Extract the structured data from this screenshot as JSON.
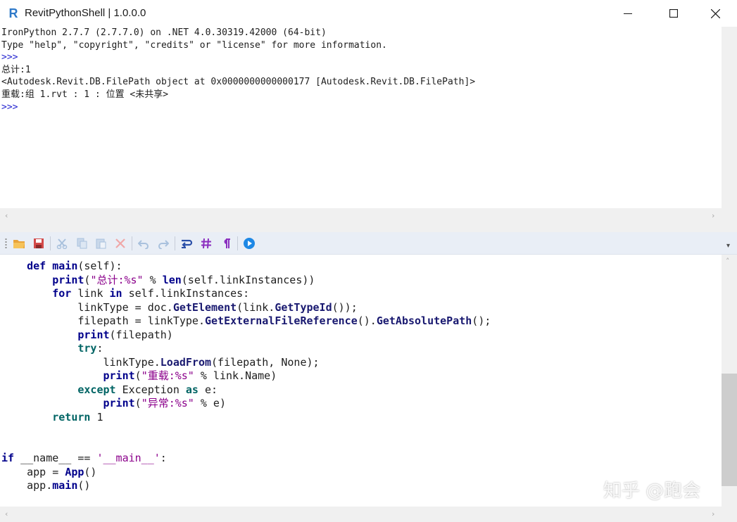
{
  "window": {
    "title": "RevitPythonShell | 1.0.0.0",
    "logo_letter": "R",
    "controls": [
      "minimize-icon",
      "maximize-icon",
      "close-icon"
    ]
  },
  "console": {
    "lines": [
      {
        "type": "output",
        "text": "IronPython 2.7.7 (2.7.7.0) on .NET 4.0.30319.42000 (64-bit)"
      },
      {
        "type": "output",
        "text": "Type \"help\", \"copyright\", \"credits\" or \"license\" for more information."
      },
      {
        "type": "prompt",
        "text": ">>>"
      },
      {
        "type": "output",
        "text": "总计:1"
      },
      {
        "type": "output",
        "text": "<Autodesk.Revit.DB.FilePath object at 0x0000000000000177 [Autodesk.Revit.DB.FilePath]>"
      },
      {
        "type": "output",
        "text": "重载:组 1.rvt : 1 : 位置 <未共享>"
      },
      {
        "type": "prompt",
        "text": ">>>"
      }
    ]
  },
  "toolbar": {
    "buttons": [
      {
        "icon": "open-folder-icon",
        "color": "#e8a33a"
      },
      {
        "icon": "save-icon",
        "color": "#d24a4a"
      },
      {
        "icon": "cut-icon",
        "color": "#a9c1dd"
      },
      {
        "icon": "copy-icon",
        "color": "#a9c1dd"
      },
      {
        "icon": "paste-icon",
        "color": "#a9c1dd"
      },
      {
        "icon": "delete-icon",
        "color": "#f0a7a7"
      },
      {
        "icon": "undo-icon",
        "color": "#a9c1dd"
      },
      {
        "icon": "redo-icon",
        "color": "#a9c1dd"
      },
      {
        "icon": "word-wrap-icon",
        "color": "#2a4fa8"
      },
      {
        "icon": "line-numbers-icon",
        "color": "#8b2fbf"
      },
      {
        "icon": "show-whitespace-icon",
        "color": "#8b2fbf"
      },
      {
        "icon": "run-icon",
        "color": "#1e88e5"
      }
    ]
  },
  "editor": {
    "tokens": [
      [
        {
          "t": "    "
        },
        {
          "t": "def",
          "c": "kw"
        },
        {
          "t": " "
        },
        {
          "t": "main",
          "c": "bi"
        },
        {
          "t": "(self):"
        }
      ],
      [
        {
          "t": "        "
        },
        {
          "t": "print",
          "c": "kw"
        },
        {
          "t": "("
        },
        {
          "t": "\"总计:%s\"",
          "c": "str"
        },
        {
          "t": " % "
        },
        {
          "t": "len",
          "c": "bi"
        },
        {
          "t": "(self.linkInstances))"
        }
      ],
      [
        {
          "t": "        "
        },
        {
          "t": "for",
          "c": "kw"
        },
        {
          "t": " link "
        },
        {
          "t": "in",
          "c": "kw"
        },
        {
          "t": " self.linkInstances:"
        }
      ],
      [
        {
          "t": "            linkType = doc."
        },
        {
          "t": "GetElement",
          "c": "me"
        },
        {
          "t": "(link."
        },
        {
          "t": "GetTypeId",
          "c": "me"
        },
        {
          "t": "());"
        }
      ],
      [
        {
          "t": "            filepath = linkType."
        },
        {
          "t": "GetExternalFileReference",
          "c": "me"
        },
        {
          "t": "()."
        },
        {
          "t": "GetAbsolutePath",
          "c": "me"
        },
        {
          "t": "();"
        }
      ],
      [
        {
          "t": "            "
        },
        {
          "t": "print",
          "c": "kw"
        },
        {
          "t": "(filepath)"
        }
      ],
      [
        {
          "t": "            "
        },
        {
          "t": "try",
          "c": "ctl"
        },
        {
          "t": ":"
        }
      ],
      [
        {
          "t": "                linkType."
        },
        {
          "t": "LoadFrom",
          "c": "me"
        },
        {
          "t": "(filepath, None);"
        }
      ],
      [
        {
          "t": "                "
        },
        {
          "t": "print",
          "c": "kw"
        },
        {
          "t": "("
        },
        {
          "t": "\"重载:%s\"",
          "c": "str"
        },
        {
          "t": " % link.Name)"
        }
      ],
      [
        {
          "t": "            "
        },
        {
          "t": "except",
          "c": "ctl"
        },
        {
          "t": " Exception "
        },
        {
          "t": "as",
          "c": "ctl"
        },
        {
          "t": " e:"
        }
      ],
      [
        {
          "t": "                "
        },
        {
          "t": "print",
          "c": "kw"
        },
        {
          "t": "("
        },
        {
          "t": "\"异常:%s\"",
          "c": "str"
        },
        {
          "t": " % e)"
        }
      ],
      [
        {
          "t": "        "
        },
        {
          "t": "return",
          "c": "ctl"
        },
        {
          "t": " 1"
        }
      ],
      [
        {
          "t": ""
        }
      ],
      [
        {
          "t": ""
        }
      ],
      [
        {
          "t": "if",
          "c": "kw"
        },
        {
          "t": " __name__ == "
        },
        {
          "t": "'__main__'",
          "c": "str"
        },
        {
          "t": ":"
        }
      ],
      [
        {
          "t": "    app = "
        },
        {
          "t": "App",
          "c": "bi"
        },
        {
          "t": "()"
        }
      ],
      [
        {
          "t": "    app."
        },
        {
          "t": "main",
          "c": "bi"
        },
        {
          "t": "()"
        }
      ]
    ]
  },
  "watermark": "知乎 @跑会"
}
